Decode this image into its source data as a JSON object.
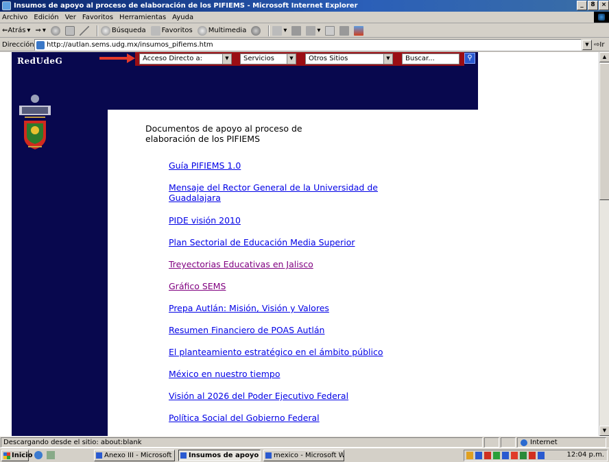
{
  "window": {
    "title": "Insumos de apoyo al proceso de elaboración de los PIFIEMS - Microsoft Internet Explorer",
    "buttons": [
      "_",
      "8",
      "×"
    ]
  },
  "menubar": [
    "Archivo",
    "Edición",
    "Ver",
    "Favoritos",
    "Herramientas",
    "Ayuda"
  ],
  "toolbar": {
    "back": "⇐Atrás",
    "search": "Búsqueda",
    "favorites": "Favoritos",
    "multimedia": "Multimedia"
  },
  "address": {
    "label": "Dirección",
    "url": "http://autlan.sems.udg.mx/insumos_pifiems.htm",
    "go": "Ir"
  },
  "site": {
    "logo": "RedUdeG",
    "nav": [
      "Acceso Directo a:",
      "Servicios",
      "Otros Sitios"
    ],
    "search_placeholder": "Buscar...",
    "heading_line1": "Documentos de apoyo al proceso de",
    "heading_line2": "elaboración de los PIFIEMS",
    "links": [
      {
        "text": "Guía PIFIEMS 1.0",
        "visited": false
      },
      {
        "text": "Mensaje del Rector General de la Universidad de",
        "text2": "Guadalajara",
        "visited": false
      },
      {
        "text": "PIDE visión 2010",
        "visited": false
      },
      {
        "text": "Plan Sectorial de Educación Media Superior",
        "visited": false
      },
      {
        "text": "Treyectorias Educativas en Jalisco",
        "visited": true
      },
      {
        "text": "Gráfico SEMS",
        "visited": true
      },
      {
        "text": "Prepa Autlán: Misión, Visión y Valores",
        "visited": false
      },
      {
        "text": "Resumen Financiero de POAS Autlán",
        "visited": false
      },
      {
        "text": "El planteamiento estratégico en el ámbito público",
        "visited": false
      },
      {
        "text": "México en nuestro tiempo",
        "visited": false
      },
      {
        "text": "Visión al 2026 del Poder Ejecutivo Federal",
        "visited": false
      },
      {
        "text": "Política Social del Gobierno Federal",
        "visited": false
      }
    ]
  },
  "status": {
    "text": "Descargando desde el sitio: about:blank",
    "zone": "Internet"
  },
  "taskbar": {
    "start": "Inicio",
    "tasks": [
      "Anexo III - Microsoft Word",
      "Insumos de apoyo al p...",
      "mexico - Microsoft Word"
    ],
    "clock": "12:04 p.m."
  }
}
